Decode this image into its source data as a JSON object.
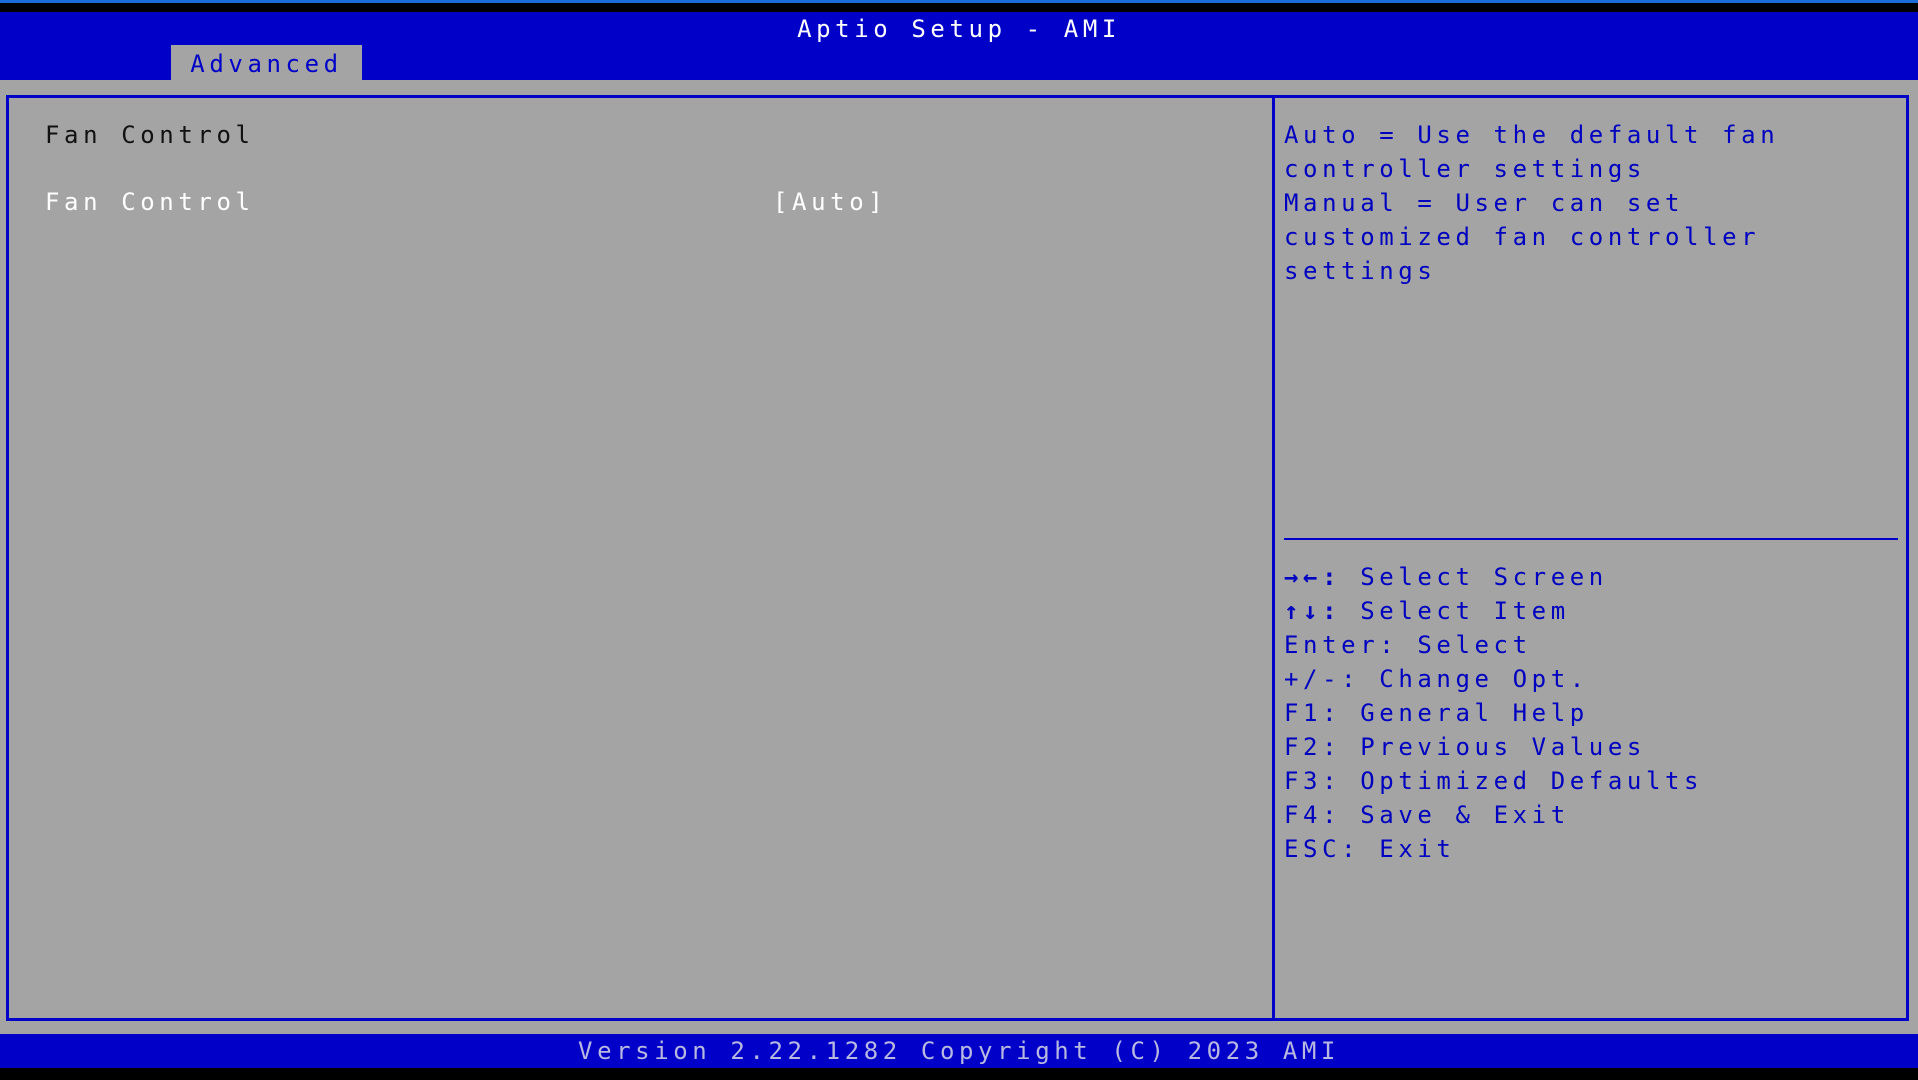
{
  "header": {
    "title": "Aptio Setup - AMI",
    "tabs": [
      {
        "label": "Advanced",
        "active": true
      }
    ]
  },
  "main": {
    "section_title": "Fan Control",
    "items": [
      {
        "label": "Fan Control",
        "value": "[Auto]",
        "selected": true
      }
    ]
  },
  "help": {
    "description": [
      "Auto = Use the default fan",
      "controller settings",
      "Manual = User can set",
      "customized fan controller",
      "settings"
    ],
    "keys": [
      {
        "key": "→←:",
        "action": "Select Screen"
      },
      {
        "key": "↑↓:",
        "action": "Select Item"
      },
      {
        "key": "Enter:",
        "action": "Select"
      },
      {
        "key": "+/-:",
        "action": "Change Opt."
      },
      {
        "key": "F1:",
        "action": "General Help"
      },
      {
        "key": "F2:",
        "action": "Previous Values"
      },
      {
        "key": "F3:",
        "action": "Optimized Defaults"
      },
      {
        "key": "F4:",
        "action": "Save & Exit"
      },
      {
        "key": "ESC:",
        "action": "Exit"
      }
    ]
  },
  "footer": {
    "text": "Version 2.22.1282 Copyright (C) 2023 AMI"
  },
  "colors": {
    "header_blue": "#0000c8",
    "panel_gray": "#a4a4a4",
    "help_text": "#0000c0"
  }
}
